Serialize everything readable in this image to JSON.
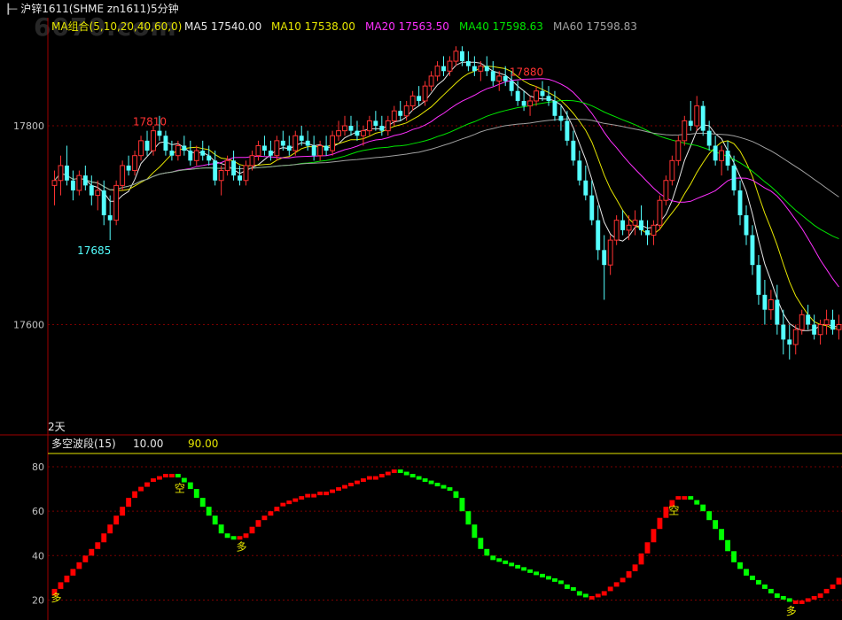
{
  "window": {
    "title": "沪锌1611(SHME zn1611)5分钟",
    "icon": "window-icon",
    "watermark": "6070.com"
  },
  "colors": {
    "up": "#ff3232",
    "down": "#54ffff",
    "ma5": "#e8e8e8",
    "ma10": "#e6e600",
    "ma20": "#ff30ff",
    "ma40": "#00e600",
    "ma60": "#a0a0a0",
    "grid": "#7a0000",
    "wave_up": "#ff0000",
    "wave_down": "#00ff00",
    "threshold": "#e6e600"
  },
  "legend": {
    "group": "MA组合(5,10,20,40,60,0)",
    "ma5": "MA5 17540.00",
    "ma10": "MA10 17538.00",
    "ma20": "MA20 17563.50",
    "ma40": "MA40 17598.63",
    "ma60": "MA60 17598.83"
  },
  "period_label": "2天",
  "sub_legend": {
    "name": "多空波段(15)",
    "v1": "10.00",
    "v2": "90.00"
  },
  "chart_data": [
    {
      "type": "candlestick",
      "title": "沪锌1611(SHME zn1611)5分钟",
      "y_ticks": [
        17600,
        17800
      ],
      "ylim": [
        17490,
        17890
      ],
      "grid": true,
      "annotations": [
        {
          "label": "17880",
          "candle": 79
        },
        {
          "label": "17810",
          "candle": 18
        },
        {
          "label": "17685",
          "candle": 9
        }
      ],
      "candles": [
        [
          17740,
          17755,
          17720,
          17745
        ],
        [
          17745,
          17770,
          17730,
          17760
        ],
        [
          17760,
          17780,
          17740,
          17745
        ],
        [
          17745,
          17755,
          17725,
          17735
        ],
        [
          17735,
          17755,
          17730,
          17750
        ],
        [
          17750,
          17760,
          17735,
          17740
        ],
        [
          17740,
          17750,
          17720,
          17730
        ],
        [
          17730,
          17745,
          17715,
          17735
        ],
        [
          17735,
          17745,
          17700,
          17710
        ],
        [
          17710,
          17730,
          17685,
          17705
        ],
        [
          17705,
          17745,
          17700,
          17740
        ],
        [
          17740,
          17765,
          17735,
          17760
        ],
        [
          17760,
          17770,
          17750,
          17755
        ],
        [
          17755,
          17775,
          17750,
          17770
        ],
        [
          17770,
          17790,
          17765,
          17785
        ],
        [
          17785,
          17795,
          17770,
          17775
        ],
        [
          17775,
          17800,
          17770,
          17795
        ],
        [
          17795,
          17810,
          17785,
          17790
        ],
        [
          17790,
          17795,
          17770,
          17775
        ],
        [
          17775,
          17785,
          17765,
          17770
        ],
        [
          17770,
          17785,
          17765,
          17780
        ],
        [
          17780,
          17790,
          17770,
          17775
        ],
        [
          17775,
          17785,
          17760,
          17765
        ],
        [
          17765,
          17780,
          17760,
          17775
        ],
        [
          17775,
          17785,
          17765,
          17770
        ],
        [
          17770,
          17780,
          17760,
          17765
        ],
        [
          17765,
          17775,
          17740,
          17745
        ],
        [
          17745,
          17760,
          17730,
          17755
        ],
        [
          17755,
          17770,
          17750,
          17765
        ],
        [
          17765,
          17775,
          17745,
          17750
        ],
        [
          17750,
          17760,
          17740,
          17745
        ],
        [
          17745,
          17765,
          17740,
          17760
        ],
        [
          17760,
          17775,
          17755,
          17770
        ],
        [
          17770,
          17785,
          17765,
          17780
        ],
        [
          17780,
          17790,
          17770,
          17775
        ],
        [
          17775,
          17785,
          17765,
          17770
        ],
        [
          17770,
          17790,
          17765,
          17785
        ],
        [
          17785,
          17795,
          17775,
          17780
        ],
        [
          17780,
          17790,
          17770,
          17775
        ],
        [
          17775,
          17795,
          17770,
          17790
        ],
        [
          17790,
          17800,
          17780,
          17785
        ],
        [
          17785,
          17795,
          17775,
          17780
        ],
        [
          17780,
          17790,
          17765,
          17770
        ],
        [
          17770,
          17785,
          17765,
          17780
        ],
        [
          17780,
          17790,
          17770,
          17775
        ],
        [
          17775,
          17795,
          17770,
          17790
        ],
        [
          17790,
          17805,
          17785,
          17795
        ],
        [
          17795,
          17810,
          17790,
          17800
        ],
        [
          17800,
          17810,
          17790,
          17795
        ],
        [
          17795,
          17805,
          17785,
          17790
        ],
        [
          17790,
          17800,
          17780,
          17795
        ],
        [
          17795,
          17810,
          17790,
          17805
        ],
        [
          17805,
          17815,
          17795,
          17800
        ],
        [
          17800,
          17810,
          17790,
          17795
        ],
        [
          17795,
          17810,
          17790,
          17805
        ],
        [
          17805,
          17820,
          17800,
          17815
        ],
        [
          17815,
          17825,
          17805,
          17810
        ],
        [
          17810,
          17825,
          17805,
          17820
        ],
        [
          17820,
          17835,
          17815,
          17830
        ],
        [
          17830,
          17840,
          17820,
          17825
        ],
        [
          17825,
          17845,
          17820,
          17840
        ],
        [
          17840,
          17855,
          17835,
          17850
        ],
        [
          17850,
          17865,
          17845,
          17860
        ],
        [
          17860,
          17870,
          17850,
          17855
        ],
        [
          17855,
          17870,
          17850,
          17865
        ],
        [
          17865,
          17880,
          17860,
          17875
        ],
        [
          17875,
          17880,
          17860,
          17865
        ],
        [
          17865,
          17875,
          17855,
          17860
        ],
        [
          17860,
          17870,
          17850,
          17855
        ],
        [
          17855,
          17865,
          17845,
          17860
        ],
        [
          17860,
          17870,
          17850,
          17855
        ],
        [
          17855,
          17865,
          17840,
          17845
        ],
        [
          17845,
          17855,
          17835,
          17850
        ],
        [
          17850,
          17860,
          17840,
          17845
        ],
        [
          17845,
          17855,
          17830,
          17835
        ],
        [
          17835,
          17845,
          17820,
          17825
        ],
        [
          17825,
          17835,
          17815,
          17820
        ],
        [
          17820,
          17830,
          17810,
          17825
        ],
        [
          17825,
          17840,
          17820,
          17835
        ],
        [
          17835,
          17845,
          17825,
          17830
        ],
        [
          17830,
          17840,
          17820,
          17825
        ],
        [
          17825,
          17835,
          17805,
          17810
        ],
        [
          17810,
          17820,
          17795,
          17805
        ],
        [
          17805,
          17815,
          17780,
          17785
        ],
        [
          17785,
          17795,
          17760,
          17765
        ],
        [
          17765,
          17775,
          17740,
          17745
        ],
        [
          17745,
          17760,
          17725,
          17730
        ],
        [
          17730,
          17745,
          17700,
          17705
        ],
        [
          17705,
          17720,
          17665,
          17675
        ],
        [
          17675,
          17690,
          17625,
          17660
        ],
        [
          17660,
          17690,
          17650,
          17685
        ],
        [
          17685,
          17710,
          17680,
          17705
        ],
        [
          17705,
          17715,
          17690,
          17695
        ],
        [
          17695,
          17710,
          17685,
          17700
        ],
        [
          17700,
          17715,
          17690,
          17705
        ],
        [
          17705,
          17720,
          17690,
          17695
        ],
        [
          17695,
          17705,
          17680,
          17690
        ],
        [
          17690,
          17705,
          17680,
          17700
        ],
        [
          17700,
          17730,
          17695,
          17725
        ],
        [
          17725,
          17750,
          17720,
          17745
        ],
        [
          17745,
          17770,
          17740,
          17765
        ],
        [
          17765,
          17790,
          17760,
          17785
        ],
        [
          17785,
          17810,
          17780,
          17805
        ],
        [
          17805,
          17825,
          17795,
          17800
        ],
        [
          17800,
          17830,
          17795,
          17820
        ],
        [
          17820,
          17825,
          17790,
          17795
        ],
        [
          17795,
          17805,
          17775,
          17780
        ],
        [
          17780,
          17790,
          17760,
          17765
        ],
        [
          17765,
          17780,
          17750,
          17775
        ],
        [
          17775,
          17785,
          17755,
          17760
        ],
        [
          17760,
          17770,
          17730,
          17735
        ],
        [
          17735,
          17745,
          17700,
          17710
        ],
        [
          17710,
          17720,
          17680,
          17690
        ],
        [
          17690,
          17700,
          17650,
          17660
        ],
        [
          17660,
          17670,
          17620,
          17630
        ],
        [
          17630,
          17645,
          17600,
          17615
        ],
        [
          17615,
          17635,
          17605,
          17625
        ],
        [
          17625,
          17640,
          17590,
          17600
        ],
        [
          17600,
          17615,
          17570,
          17585
        ],
        [
          17585,
          17600,
          17565,
          17580
        ],
        [
          17580,
          17600,
          17570,
          17595
        ],
        [
          17595,
          17615,
          17590,
          17610
        ],
        [
          17610,
          17620,
          17595,
          17600
        ],
        [
          17600,
          17610,
          17585,
          17590
        ],
        [
          17590,
          17605,
          17580,
          17600
        ],
        [
          17600,
          17615,
          17590,
          17605
        ],
        [
          17605,
          17615,
          17590,
          17595
        ],
        [
          17595,
          17610,
          17585,
          17600
        ]
      ],
      "ma_series": [
        {
          "name": "MA5",
          "period": 5
        },
        {
          "name": "MA10",
          "period": 10
        },
        {
          "name": "MA20",
          "period": 20
        },
        {
          "name": "MA40",
          "period": 40
        },
        {
          "name": "MA60",
          "period": 60
        }
      ]
    },
    {
      "type": "bar",
      "title": "多空波段(15)",
      "y_ticks": [
        20,
        40,
        60,
        80
      ],
      "ylim": [
        11,
        86
      ],
      "grid": true,
      "thresholds": [
        10.0,
        90.0
      ],
      "signals": [
        {
          "label": "多",
          "bar": 0
        },
        {
          "label": "空",
          "bar": 20
        },
        {
          "label": "多",
          "bar": 30
        },
        {
          "label": "空",
          "bar": 100
        },
        {
          "label": "多",
          "bar": 119
        }
      ],
      "values": [
        25,
        28,
        31,
        34,
        37,
        40,
        43,
        46,
        50,
        54,
        58,
        62,
        66,
        69,
        71,
        73,
        74,
        75,
        76,
        76,
        75,
        73,
        70,
        66,
        62,
        58,
        54,
        50,
        48,
        47,
        48,
        50,
        53,
        56,
        58,
        60,
        62,
        63,
        64,
        65,
        66,
        67,
        67,
        68,
        68,
        69,
        70,
        71,
        72,
        73,
        74,
        75,
        75,
        76,
        77,
        78,
        77,
        76,
        75,
        74,
        73,
        72,
        71,
        70,
        69,
        66,
        60,
        54,
        48,
        43,
        40,
        38,
        37,
        36,
        35,
        34,
        33,
        32,
        31,
        30,
        29,
        28,
        27,
        25,
        24,
        22,
        21,
        21,
        22,
        24,
        26,
        28,
        30,
        33,
        36,
        41,
        46,
        52,
        57,
        62,
        65,
        66,
        66,
        65,
        63,
        60,
        56,
        52,
        47,
        42,
        37,
        34,
        31,
        29,
        27,
        25,
        23,
        21,
        20,
        19,
        19,
        19,
        20,
        21,
        23,
        25,
        27,
        30
      ]
    }
  ]
}
